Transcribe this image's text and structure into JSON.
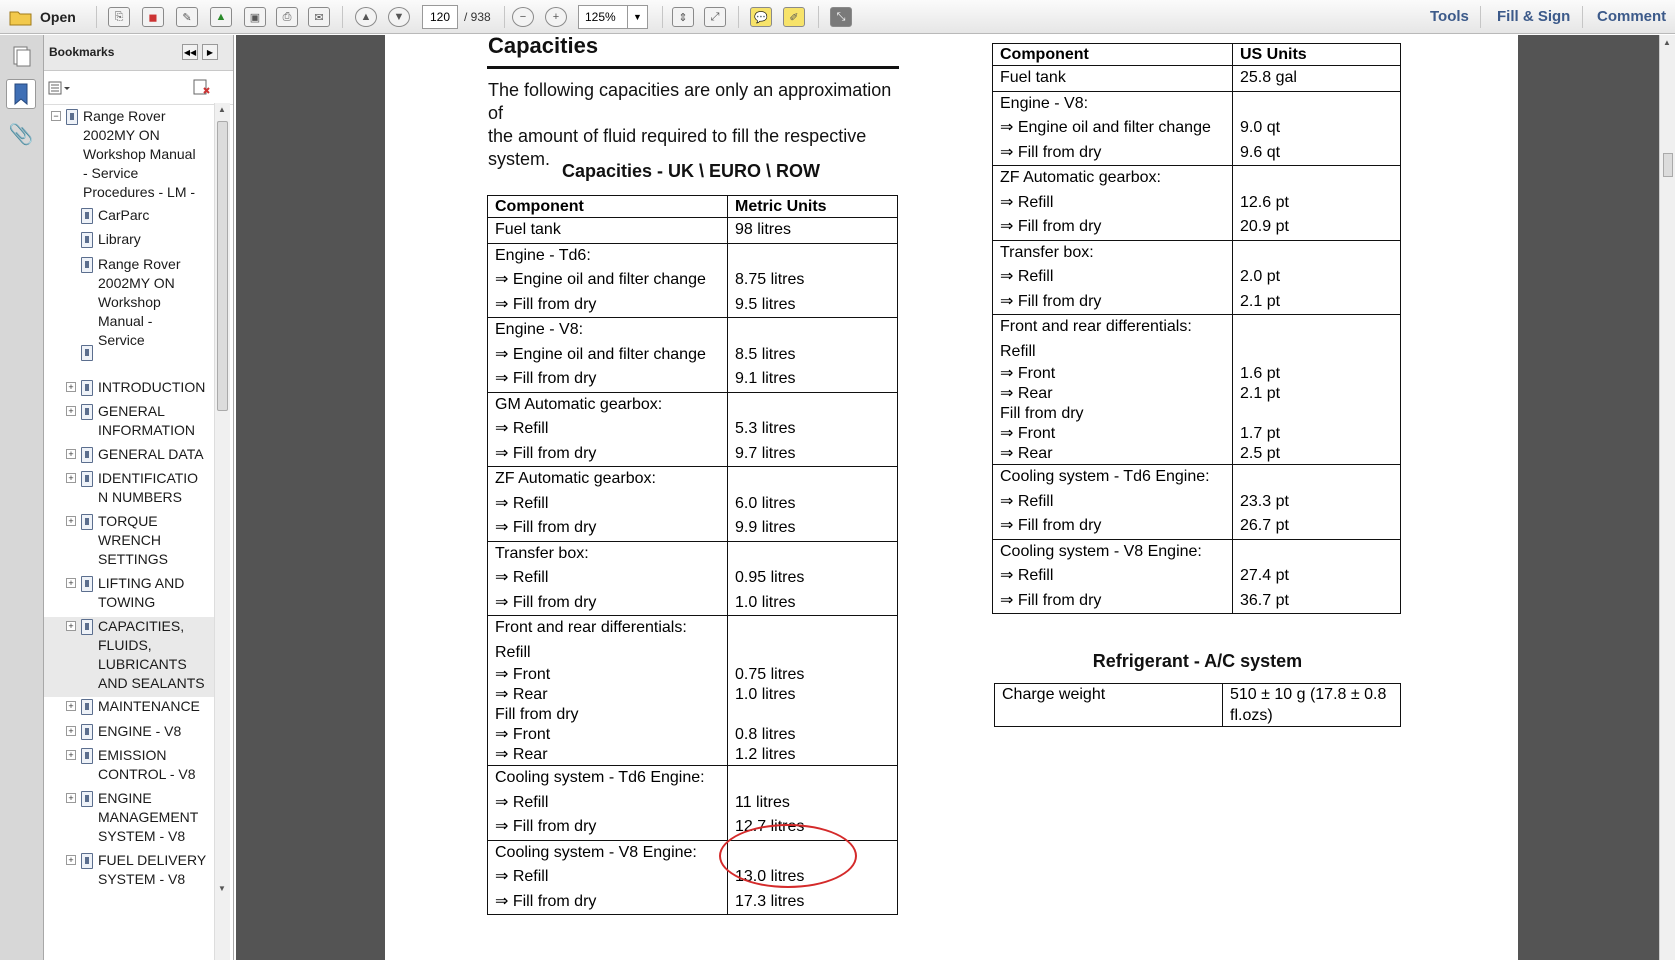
{
  "toolbar": {
    "open_label": "Open",
    "page_current": "120",
    "page_total": "/ 938",
    "zoom": "125%",
    "tools_label": "Tools",
    "fill_sign_label": "Fill & Sign",
    "comment_label": "Comment"
  },
  "bookmarks": {
    "title": "Bookmarks",
    "items": [
      {
        "label": [
          "Range Rover",
          "2002MY ON",
          "Workshop Manual",
          "- Service",
          "Procedures - LM -"
        ]
      },
      {
        "label": [
          "CarParc"
        ]
      },
      {
        "label": [
          "Library"
        ]
      },
      {
        "label": [
          "Range Rover",
          "2002MY ON",
          "Workshop",
          "Manual -",
          "Service"
        ]
      },
      {
        "label": [
          ""
        ]
      },
      {
        "label": [
          "INTRODUCTION"
        ]
      },
      {
        "label": [
          "GENERAL",
          "INFORMATION"
        ]
      },
      {
        "label": [
          "GENERAL DATA"
        ]
      },
      {
        "label": [
          "IDENTIFICATIO",
          "N NUMBERS"
        ]
      },
      {
        "label": [
          "TORQUE",
          "WRENCH",
          "SETTINGS"
        ]
      },
      {
        "label": [
          "LIFTING AND",
          "TOWING"
        ]
      },
      {
        "label": [
          "CAPACITIES,",
          "FLUIDS,",
          "LUBRICANTS",
          "AND SEALANTS"
        ]
      },
      {
        "label": [
          "MAINTENANCE"
        ]
      },
      {
        "label": [
          "ENGINE - V8"
        ]
      },
      {
        "label": [
          "EMISSION",
          "CONTROL - V8"
        ]
      },
      {
        "label": [
          "ENGINE",
          "MANAGEMENT",
          "SYSTEM - V8"
        ]
      },
      {
        "label": [
          "FUEL DELIVERY",
          "SYSTEM - V8"
        ]
      }
    ]
  },
  "doc": {
    "heading": "Capacities",
    "intro": [
      "The following capacities are only an approximation of",
      "the amount of fluid required to fill the respective",
      "system."
    ],
    "uk_title": "Capacities - UK \\ EURO \\ ROW",
    "uk_table": {
      "headers": [
        "Component",
        "Metric Units"
      ],
      "rows": [
        {
          "c": [
            "Fuel tank"
          ],
          "v": [
            "98 litres"
          ]
        },
        {
          "c": [
            "Engine - Td6:",
            "⇒ Engine oil and filter change",
            "⇒ Fill from dry"
          ],
          "v": [
            "",
            "8.75 litres",
            "9.5 litres"
          ]
        },
        {
          "c": [
            "Engine - V8:",
            "⇒ Engine oil and filter change",
            "⇒ Fill from dry"
          ],
          "v": [
            "",
            "8.5 litres",
            "9.1 litres"
          ]
        },
        {
          "c": [
            "GM Automatic gearbox:",
            "⇒ Refill",
            "⇒ Fill from dry"
          ],
          "v": [
            "",
            "5.3 litres",
            "9.7 litres"
          ]
        },
        {
          "c": [
            "ZF Automatic gearbox:",
            "⇒ Refill",
            "⇒ Fill from dry"
          ],
          "v": [
            "",
            "6.0 litres",
            "9.9 litres"
          ]
        },
        {
          "c": [
            "Transfer box:",
            "⇒ Refill",
            "⇒ Fill from dry"
          ],
          "v": [
            "",
            "0.95 litres",
            "1.0 litres"
          ]
        },
        {
          "c": [
            "Front and rear differentials:",
            "Refill",
            "⇒ Front",
            "⇒ Rear",
            " Fill from dry",
            "⇒ Front",
            "⇒ Rear"
          ],
          "v": [
            "",
            "",
            "0.75 litres",
            "1.0 litres",
            "",
            "0.8 litres",
            "1.2 litres"
          ]
        },
        {
          "c": [
            "Cooling system - Td6 Engine:",
            "⇒ Refill",
            "⇒ Fill from dry"
          ],
          "v": [
            "",
            "11 litres",
            "12.7 litres"
          ]
        },
        {
          "c": [
            "Cooling system - V8 Engine:",
            "⇒ Refill",
            "⇒ Fill from dry"
          ],
          "v": [
            "",
            "13.0 litres",
            "17.3 litres"
          ]
        }
      ]
    },
    "us_table": {
      "headers": [
        "Component",
        "US Units"
      ],
      "rows": [
        {
          "c": [
            "Fuel tank"
          ],
          "v": [
            "25.8 gal"
          ]
        },
        {
          "c": [
            "Engine - V8:",
            "⇒ Engine oil and filter change",
            "⇒ Fill from dry"
          ],
          "v": [
            "",
            "9.0 qt",
            "9.6 qt"
          ]
        },
        {
          "c": [
            "ZF Automatic gearbox:",
            "⇒ Refill",
            "⇒ Fill from dry"
          ],
          "v": [
            "",
            "12.6 pt",
            "20.9 pt"
          ]
        },
        {
          "c": [
            "Transfer box:",
            "⇒ Refill",
            "⇒ Fill from dry"
          ],
          "v": [
            "",
            "2.0 pt",
            "2.1 pt"
          ]
        },
        {
          "c": [
            "Front and rear differentials:",
            "Refill",
            "⇒ Front",
            "⇒ Rear",
            " Fill from dry",
            "⇒ Front",
            "⇒ Rear"
          ],
          "v": [
            "",
            "",
            "1.6 pt",
            "2.1 pt",
            "",
            "1.7 pt",
            "2.5 pt"
          ]
        },
        {
          "c": [
            "Cooling system - Td6 Engine:",
            "⇒ Refill",
            "⇒ Fill from dry"
          ],
          "v": [
            "",
            "23.3 pt",
            "26.7 pt"
          ]
        },
        {
          "c": [
            "Cooling system - V8 Engine:",
            "⇒ Refill",
            "⇒ Fill from dry"
          ],
          "v": [
            "",
            "27.4 pt",
            "36.7 pt"
          ]
        }
      ]
    },
    "refrigerant_title": "Refrigerant - A/C system",
    "refrigerant": {
      "c": "Charge weight",
      "v": [
        "510 ± 10 g (17.8 ± 0.8",
        "fl.ozs)"
      ]
    }
  },
  "colors": {
    "annotation": "#d42a2a",
    "link": "#3c5a8a",
    "doc_bg": "#545454"
  }
}
